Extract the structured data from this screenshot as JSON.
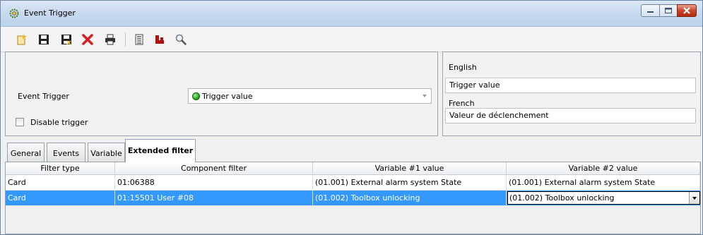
{
  "window": {
    "title": "Event Trigger"
  },
  "toolbar": {
    "buttons": [
      {
        "name": "new-icon",
        "color": "#e7b92b"
      },
      {
        "name": "save-icon",
        "color": "#222222"
      },
      {
        "name": "save-close-icon",
        "color": "#222222"
      },
      {
        "name": "delete-icon",
        "color": "#d81e1e"
      },
      {
        "name": "print-icon",
        "color": "#333333"
      },
      {
        "name": "list-icon",
        "color": "#444444"
      },
      {
        "name": "link-icon",
        "color": "#b01010"
      },
      {
        "name": "search-icon",
        "color": "#777777"
      }
    ]
  },
  "general": {
    "event_trigger_label": "Event Trigger",
    "event_trigger_value": "Trigger value",
    "disable_trigger_label": "Disable trigger"
  },
  "translations": {
    "english_label": "English",
    "english_value": "Trigger value",
    "french_label": "French",
    "french_value": "Valeur de déclenchement"
  },
  "tabs": [
    "General",
    "Events",
    "Variable",
    "Extended filter"
  ],
  "grid": {
    "columns": [
      "Filter type",
      "Component filter",
      "Variable #1 value",
      "Variable #2 value"
    ],
    "rows": [
      [
        "Card",
        "01:06388",
        "(01.001) External alarm system State",
        "(01.001) External alarm system State"
      ],
      [
        "Card",
        "01:15501 User #08",
        "(01.002) Toolbox unlocking",
        "(01.002) Toolbox unlocking"
      ]
    ]
  },
  "colors": {
    "selection": "#3399ff",
    "close_button": "#c9452b"
  }
}
